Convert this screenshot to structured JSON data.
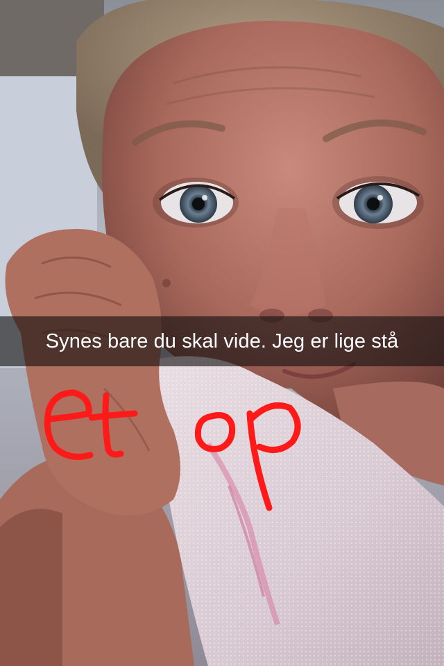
{
  "snap": {
    "caption": "Synes bare du skal vide. Jeg er lige stå",
    "doodle_text": "et op",
    "doodle_color": "#ff1a1a",
    "caption_bar_color": "#141010"
  }
}
